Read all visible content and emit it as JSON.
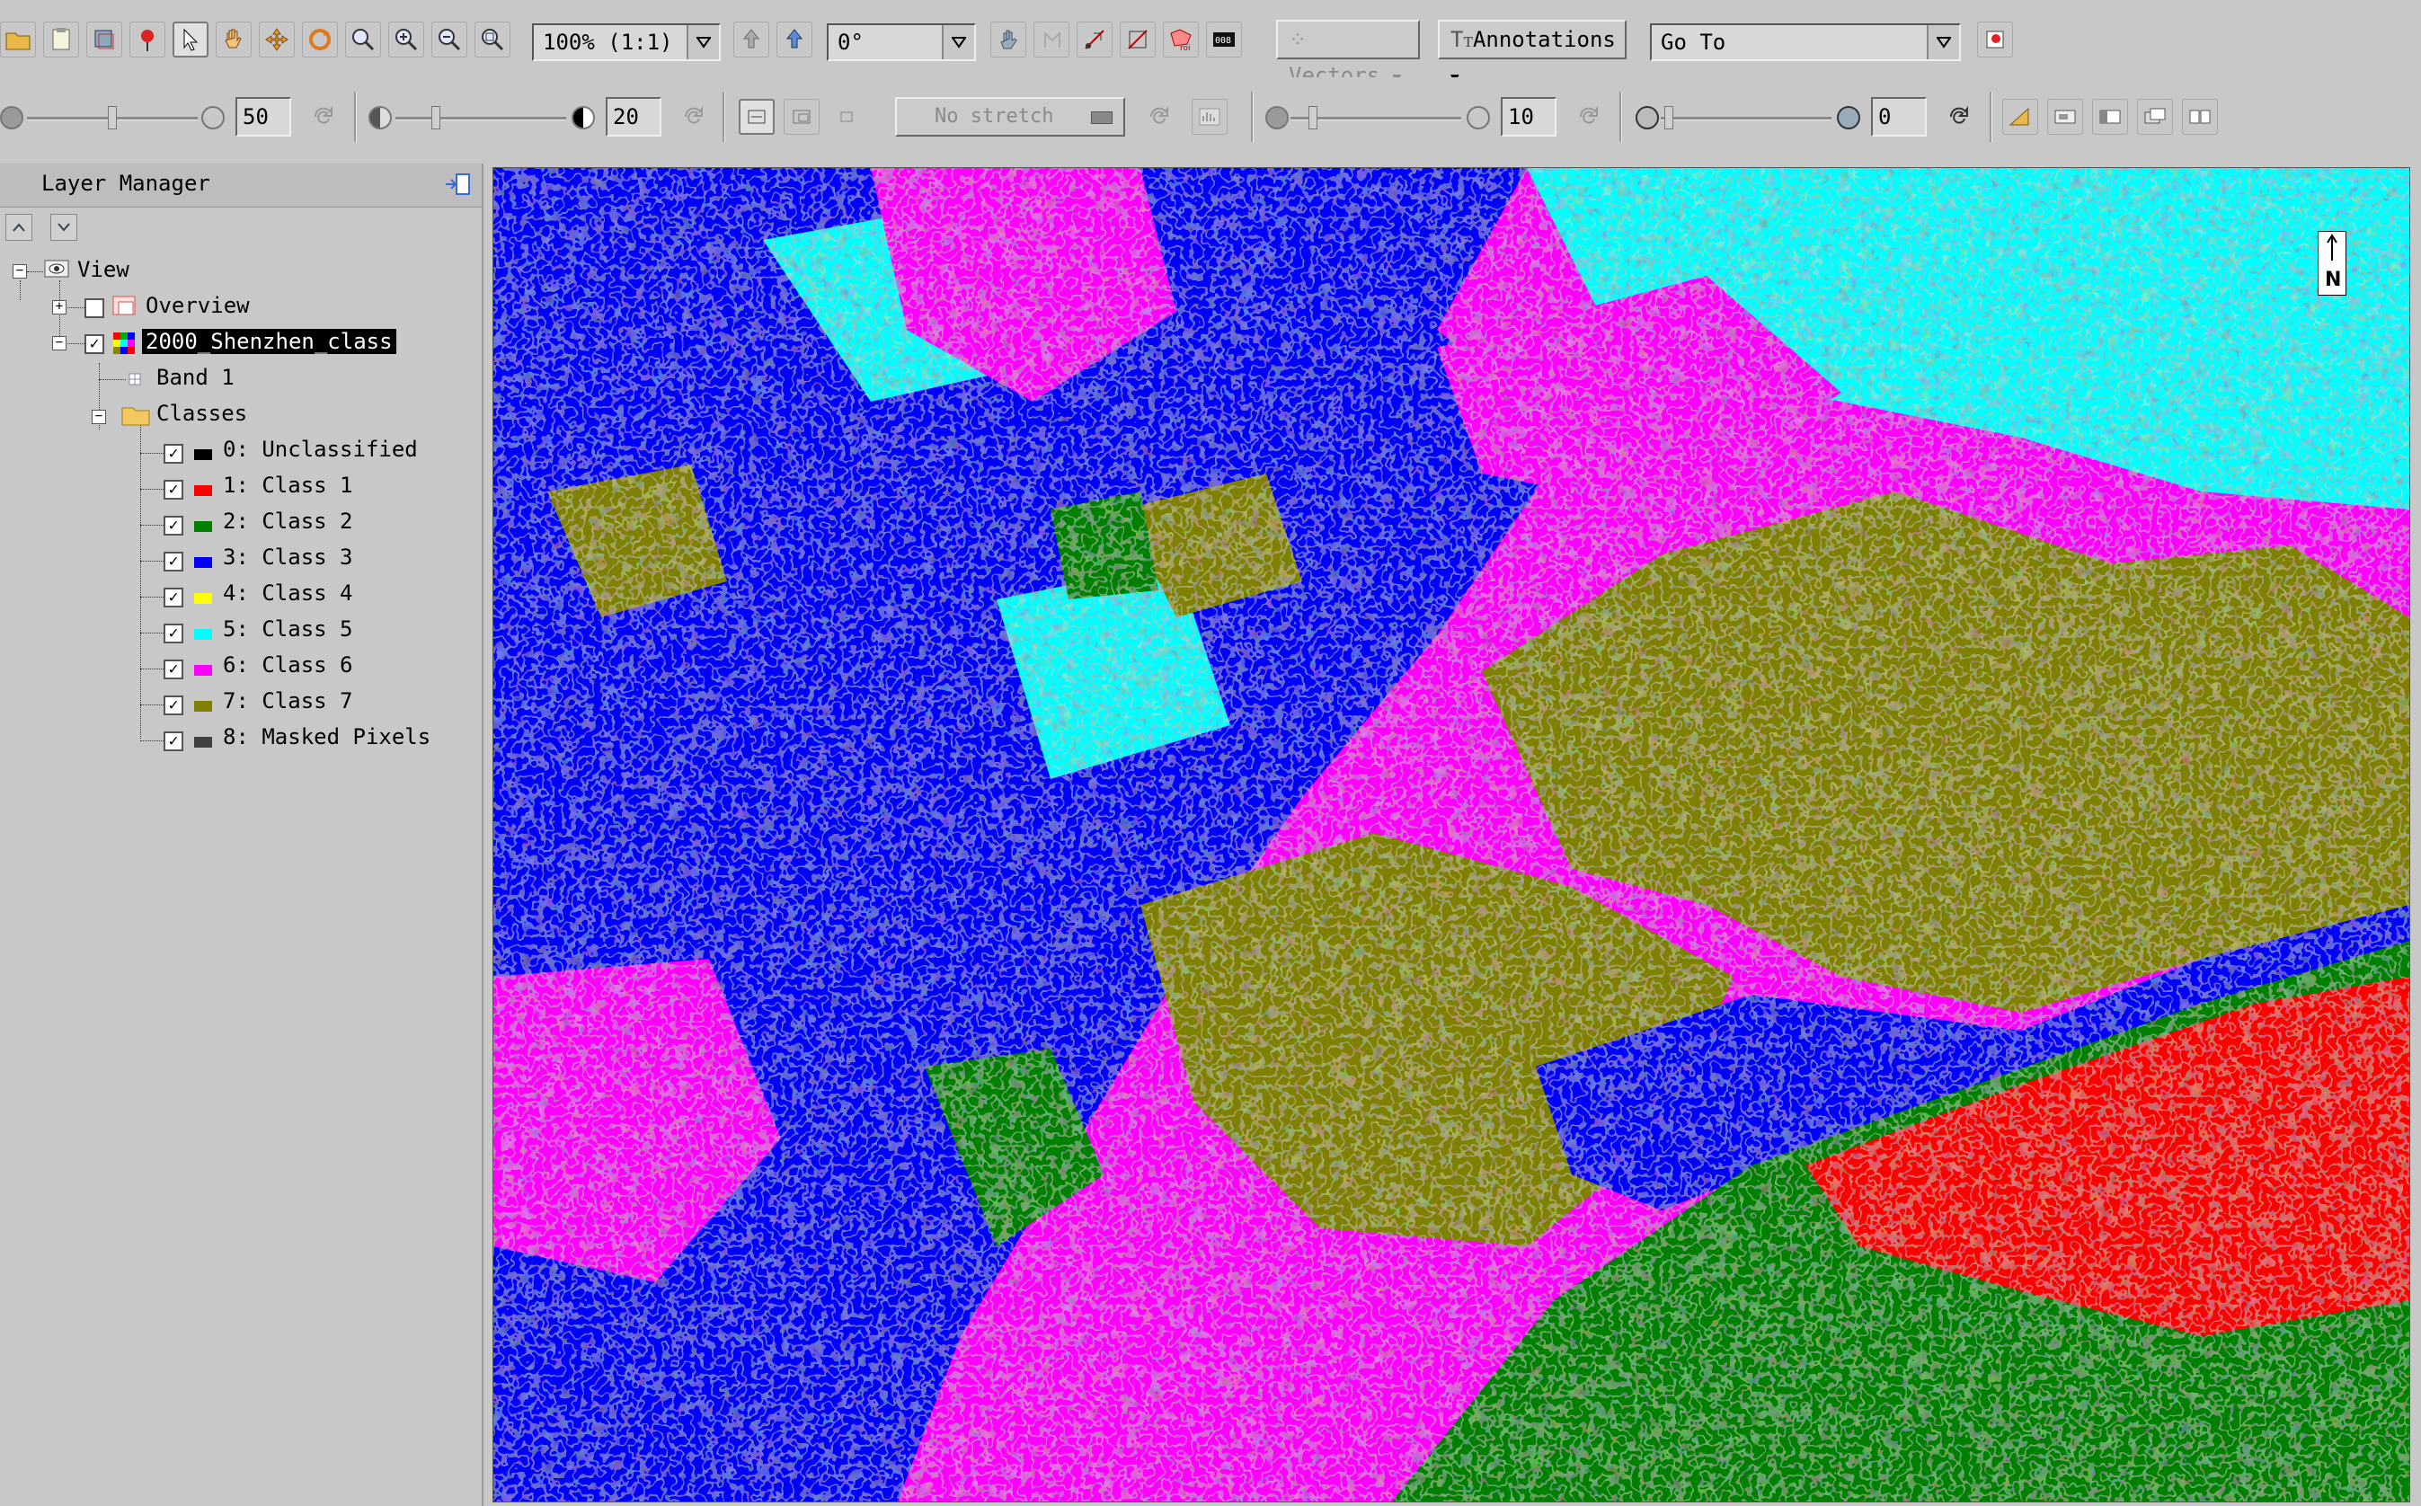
{
  "toolbar": {
    "zoom_value": "100% (1:1)",
    "rotation_value": "0°",
    "vectors_label": "Vectors",
    "annotations_label": "Annotations",
    "goto_placeholder": "Go To",
    "icons": [
      "open-folder-icon",
      "data-manager-icon",
      "layer-icon",
      "pin-icon",
      "select-pointer-icon",
      "pan-hand-icon",
      "fly-icon",
      "rotate-icon",
      "zoom-box-icon",
      "zoom-in-icon",
      "zoom-out-icon",
      "zoom-full-icon"
    ]
  },
  "toolbar2": {
    "brightness_value": "50",
    "contrast_value": "20",
    "stretch_label": "No stretch",
    "sharpen_value": "10",
    "transparency_value": "0"
  },
  "layer_manager": {
    "title": "Layer Manager",
    "view_label": "View",
    "overview_label": "Overview",
    "layer_name": "2000_Shenzhen_class",
    "band_label": "Band 1",
    "classes_label": "Classes",
    "classes": [
      {
        "label": "0: Unclassified",
        "color": "#000000"
      },
      {
        "label": "1: Class 1",
        "color": "#ff0000"
      },
      {
        "label": "2: Class 2",
        "color": "#008000"
      },
      {
        "label": "3: Class 3",
        "color": "#0000ff"
      },
      {
        "label": "4: Class 4",
        "color": "#ffff00"
      },
      {
        "label": "5: Class 5",
        "color": "#00ffff"
      },
      {
        "label": "6: Class 6",
        "color": "#ff00ff"
      },
      {
        "label": "7: Class 7",
        "color": "#808000"
      },
      {
        "label": "8: Masked Pixels",
        "color": "#404040"
      }
    ]
  },
  "map": {
    "north_label": "N"
  }
}
